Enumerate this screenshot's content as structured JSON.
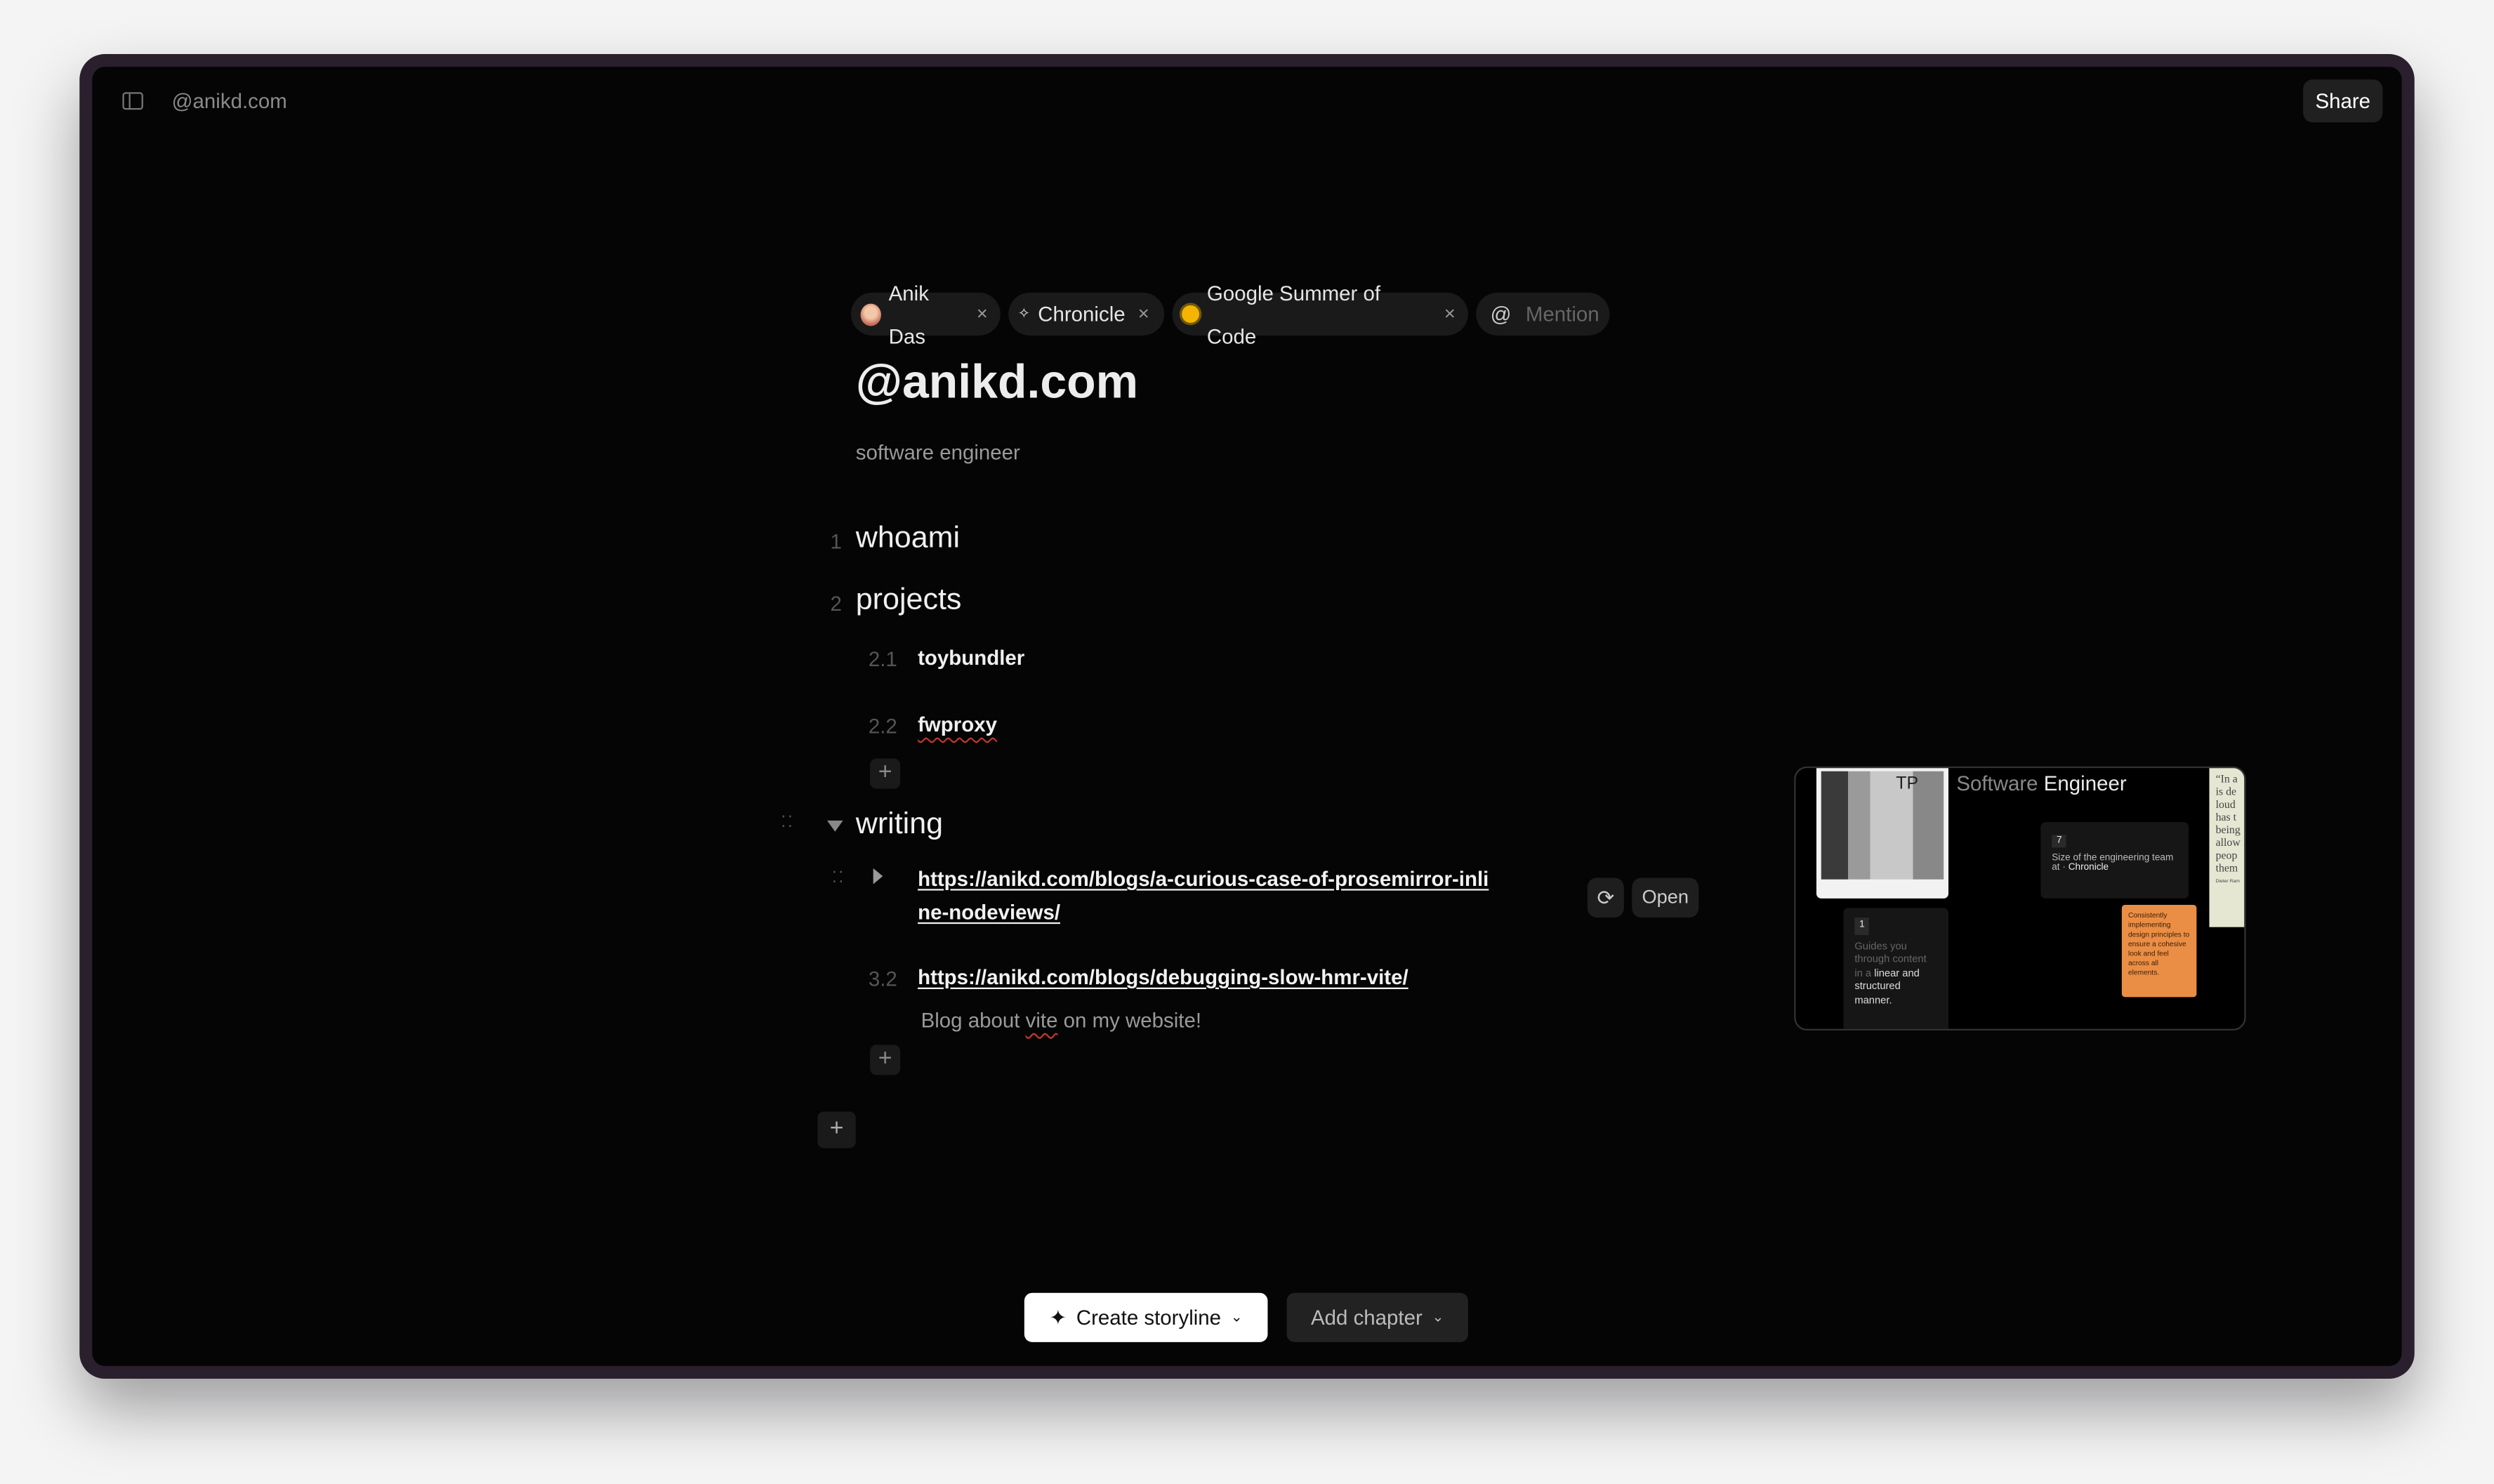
{
  "header": {
    "breadcrumb": "@anikd.com",
    "share_label": "Share"
  },
  "chips": [
    {
      "label": "Anik Das",
      "icon": "avatar",
      "remove": "×"
    },
    {
      "label": "Chronicle",
      "icon": "sparkle-icon",
      "remove": "×"
    },
    {
      "label": "Google Summer of Code",
      "icon": "gsoc-logo",
      "remove": "×"
    },
    {
      "label": "Mention",
      "icon": "at-icon",
      "prefix": "@"
    }
  ],
  "page": {
    "title": "@anikd.com",
    "subtitle": "software engineer"
  },
  "outline": {
    "s1": {
      "num": "1",
      "label": "whoami"
    },
    "s2": {
      "num": "2",
      "label": "projects",
      "items": [
        {
          "num": "2.1",
          "label": "toybundler"
        },
        {
          "num": "2.2",
          "label": "fwproxy"
        }
      ]
    },
    "s3": {
      "label": "writing",
      "items": [
        {
          "label": "https://anikd.com/blogs/a-curious-case-of-prosemirror-inline-nodeviews/"
        },
        {
          "num": "3.2",
          "label": "https://anikd.com/blogs/debugging-slow-hmr-vite/",
          "description_pre": "Blog about ",
          "description_spell": "vite",
          "description_post": " on my website!"
        }
      ]
    },
    "plus": "+",
    "open_label": "Open"
  },
  "footer": {
    "create_label": "Create storyline",
    "add_chapter_label": "Add chapter"
  },
  "preview": {
    "title_light": "Software",
    "title_strong": "Engineer",
    "image_text": "TP",
    "card7": {
      "badge": "7",
      "text": "Size of the engineering team at",
      "chip": "Chronicle"
    },
    "card1": {
      "badge": "1",
      "muted": "Guides you through content in a",
      "strong": "linear and structured manner."
    },
    "note": "Consistently implementing design principles to ensure a cohesive look and feel across all elements.",
    "quote": "“In a is de loud has t being allow peop them",
    "quote_author": "Dieter Ram",
    "note_color": "#eb8e45"
  },
  "colors": {
    "background": "#050505",
    "accent_white": "#ffffff",
    "frame": "#2a1f2c"
  }
}
